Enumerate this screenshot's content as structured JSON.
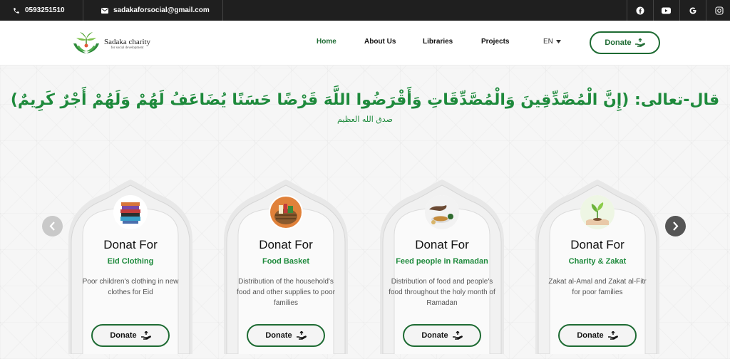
{
  "topbar": {
    "phone": "0593251510",
    "email": "sadakaforsocial@gmail.com",
    "social": [
      "facebook-icon",
      "youtube-icon",
      "google-icon",
      "instagram-icon"
    ]
  },
  "brand": {
    "name": "Sadaka charity",
    "tagline": "for social development"
  },
  "nav": {
    "items": [
      {
        "label": "Home",
        "active": true
      },
      {
        "label": "About Us",
        "active": false
      },
      {
        "label": "Libraries",
        "active": false
      },
      {
        "label": "Projects",
        "active": false
      }
    ],
    "language": "EN",
    "donate_label": "Donate"
  },
  "hero": {
    "verse": "قال-تعالى: (إِنَّ الْمُصَّدِّقِينَ وَالْمُصَّدِّقَاتِ وَأَقْرَضُوا اللَّهَ قَرْضًا حَسَنًا يُضَاعَفُ لَهُمْ وَلَهُمْ أَجْرٌ كَرِيمٌ)",
    "verse_source": "صدق الله العظيم"
  },
  "cards": [
    {
      "title": "Donat For",
      "subtitle": "Eid Clothing",
      "description": "Poor children's clothing in new clothes for Eid",
      "button": "Donate",
      "image": "clothing-image"
    },
    {
      "title": "Donat For",
      "subtitle": "Food Basket",
      "description": "Distribution of the household's food and other supplies to poor families",
      "button": "Donate",
      "image": "food-basket-image"
    },
    {
      "title": "Donat For",
      "subtitle": "Feed people in Ramadan",
      "description": "Distribution of food and people's food throughout the holy month of Ramadan",
      "button": "Donate",
      "image": "ramadan-food-image"
    },
    {
      "title": "Donat For",
      "subtitle": "Charity & Zakat",
      "description": "Zakat al-Amal and Zakat al-Fitr for poor families",
      "button": "Donate",
      "image": "charity-plant-image"
    }
  ],
  "colors": {
    "primary": "#1e6b33",
    "accent": "#1e8a3c",
    "topbar": "#1f1f1f"
  }
}
